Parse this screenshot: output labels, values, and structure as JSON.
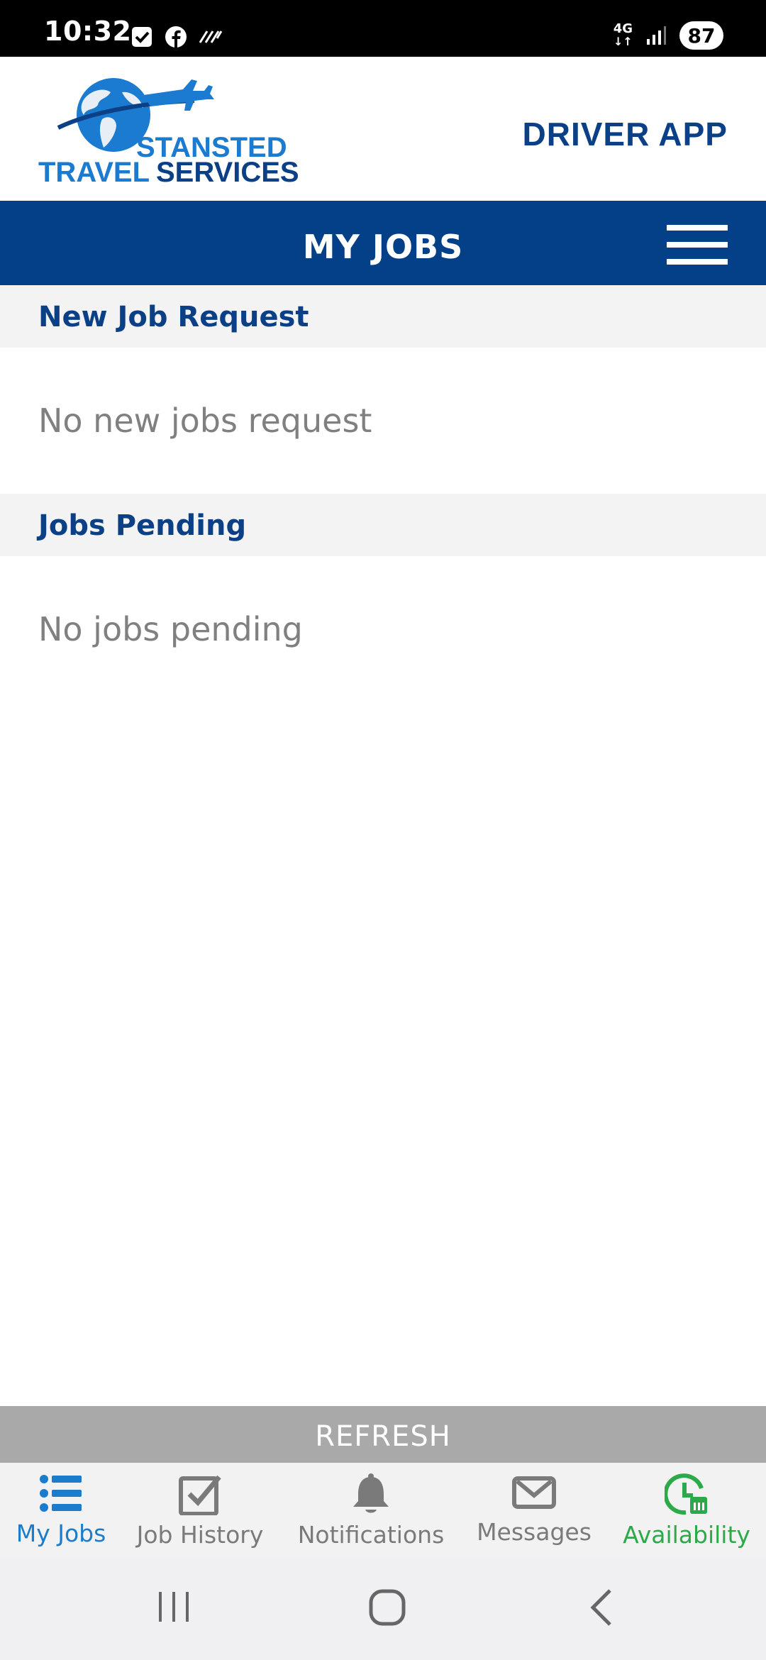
{
  "status_bar": {
    "time": "10:32",
    "network": "4G",
    "battery": "87",
    "icons": [
      "checkbox-notification-icon",
      "facebook-icon",
      "data-saver-icon",
      "signal-icon"
    ]
  },
  "header": {
    "logo_line1": "STANSTED",
    "logo_line2a": "TRAVEL",
    "logo_line2b": "SERVICES",
    "app_label": "DRIVER APP"
  },
  "title_bar": {
    "title": "MY JOBS",
    "menu_icon": "hamburger-menu-icon"
  },
  "sections": {
    "new_requests": {
      "heading": "New Job Request",
      "empty_text": "No new jobs request"
    },
    "pending": {
      "heading": "Jobs Pending",
      "empty_text": "No jobs pending"
    }
  },
  "refresh_label": "REFRESH",
  "bottom_nav": {
    "items": [
      {
        "label": "My Jobs",
        "icon": "list-icon",
        "color": "#1c7ccc",
        "active": true
      },
      {
        "label": "Job History",
        "icon": "checkbox-icon",
        "color": "#7a7a7a"
      },
      {
        "label": "Notifications",
        "icon": "bell-icon",
        "color": "#7a7a7a"
      },
      {
        "label": "Messages",
        "icon": "envelope-icon",
        "color": "#7a7a7a"
      },
      {
        "label": "Availability",
        "icon": "clock-calendar-icon",
        "color": "#2caa4a"
      }
    ]
  },
  "colors": {
    "brand_blue": "#034088",
    "heading_blue": "#0b3f86",
    "section_bg": "#f3f3f4",
    "refresh_bg": "#a9a9a9"
  }
}
